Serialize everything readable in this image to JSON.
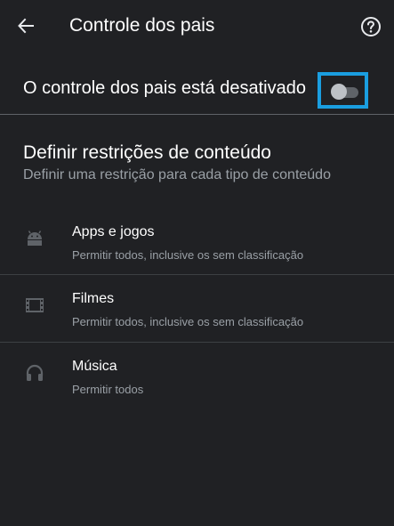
{
  "appbar": {
    "title": "Controle dos pais",
    "back_icon": "arrow-left-icon",
    "help_icon": "help-circle-icon"
  },
  "master": {
    "label": "O controle dos pais está desativado",
    "toggle_on": false
  },
  "section": {
    "title": "Definir restrições de conteúdo",
    "subtitle": "Definir uma restrição para cada tipo de conteúdo"
  },
  "items": [
    {
      "title": "Apps e jogos",
      "subtitle": "Permitir todos, inclusive os sem classificação",
      "icon": "android-icon"
    },
    {
      "title": "Filmes",
      "subtitle": "Permitir todos, inclusive os sem classificação",
      "icon": "film-icon"
    },
    {
      "title": "Música",
      "subtitle": "Permitir todos",
      "icon": "headphones-icon"
    }
  ],
  "colors": {
    "background": "#202124",
    "highlight": "#1a9ee0",
    "secondary_text": "#9aa0a6"
  }
}
